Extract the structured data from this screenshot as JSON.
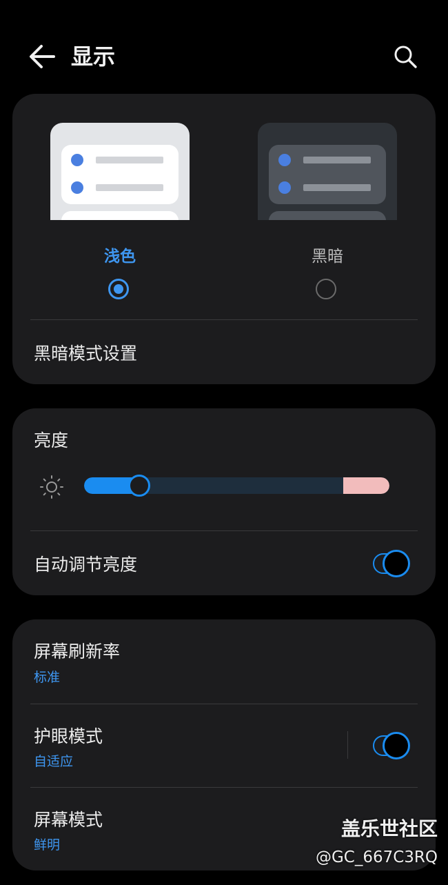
{
  "header": {
    "title": "显示",
    "back_icon": "arrow-left-icon",
    "search_icon": "search-icon"
  },
  "theme": {
    "light_label": "浅色",
    "dark_label": "黑暗",
    "selected": "light",
    "dark_mode_settings": "黑暗模式设置"
  },
  "brightness": {
    "title": "亮度",
    "level_percent": 18,
    "auto_label": "自动调节亮度",
    "auto_on": true
  },
  "display": {
    "refresh_rate_label": "屏幕刷新率",
    "refresh_rate_value": "标准",
    "eye_comfort_label": "护眼模式",
    "eye_comfort_value": "自适应",
    "eye_comfort_on": true,
    "screen_mode_label": "屏幕模式",
    "screen_mode_value": "鲜明"
  },
  "watermark": {
    "line1": "盖乐世社区",
    "line2": "@GC_667C3RQ"
  },
  "colors": {
    "accent": "#3e96f0",
    "card": "#1c1c1e",
    "background": "#000000",
    "slider_cap": "#f2bcbc"
  }
}
